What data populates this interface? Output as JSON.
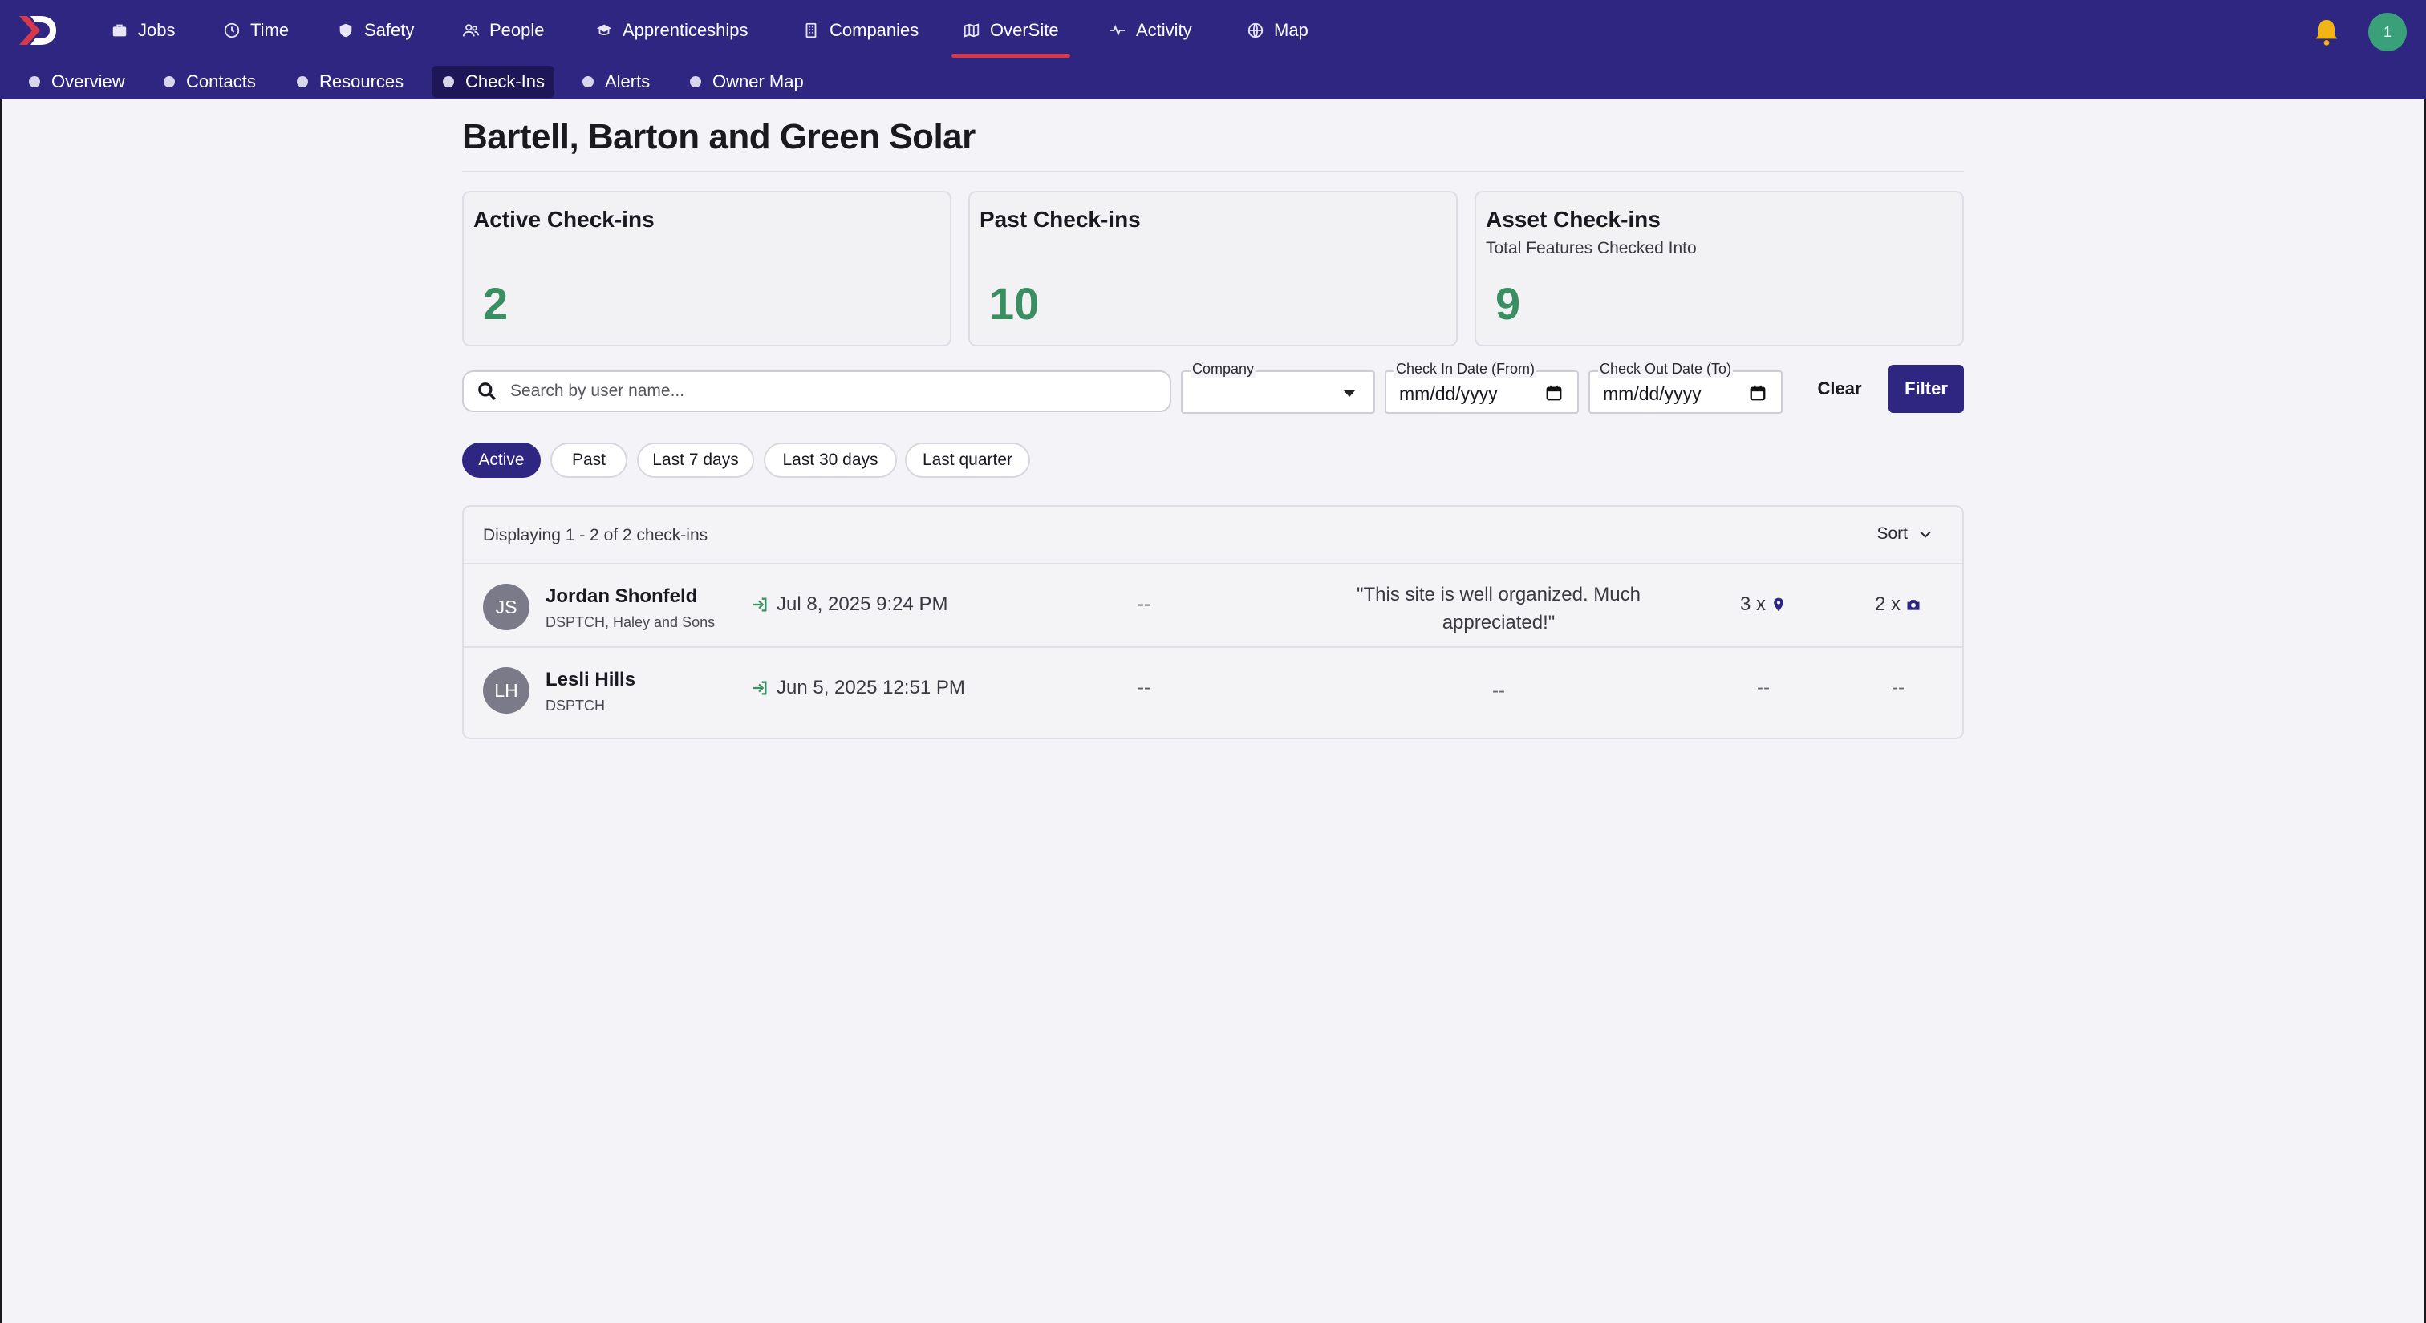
{
  "nav": {
    "items": [
      {
        "label": "Jobs",
        "icon": "briefcase-icon"
      },
      {
        "label": "Time",
        "icon": "clock-icon"
      },
      {
        "label": "Safety",
        "icon": "shield-icon"
      },
      {
        "label": "People",
        "icon": "people-icon"
      },
      {
        "label": "Apprenticeships",
        "icon": "graduation-cap-icon"
      },
      {
        "label": "Companies",
        "icon": "building-icon"
      },
      {
        "label": "OverSite",
        "icon": "map-icon",
        "active": true
      },
      {
        "label": "Activity",
        "icon": "pulse-icon"
      },
      {
        "label": "Map",
        "icon": "globe-icon"
      }
    ],
    "notification_count": "1"
  },
  "subnav": {
    "items": [
      "Overview",
      "Contacts",
      "Resources",
      "Check-Ins",
      "Alerts",
      "Owner Map"
    ],
    "active": "Check-Ins"
  },
  "page": {
    "title": "Bartell, Barton and Green Solar"
  },
  "cards": [
    {
      "label": "Active Check-ins",
      "sublabel": "",
      "value": "2"
    },
    {
      "label": "Past Check-ins",
      "sublabel": "",
      "value": "10"
    },
    {
      "label": "Asset Check-ins",
      "sublabel": "Total Features Checked Into",
      "value": "9"
    }
  ],
  "filters": {
    "search_placeholder": "Search by user name...",
    "company_label": "Company",
    "company_value": "",
    "checkin_label": "Check In Date (From)",
    "checkin_value": "mm/dd/yyyy",
    "checkout_label": "Check Out Date (To)",
    "checkout_value": "mm/dd/yyyy",
    "clear_label": "Clear",
    "filter_label": "Filter",
    "quick": [
      "Active",
      "Past",
      "Last 7 days",
      "Last 30 days",
      "Last quarter"
    ],
    "quick_active": "Active"
  },
  "table": {
    "count_text": "Displaying 1 - 2 of 2 check-ins",
    "sort_label": "Sort",
    "rows": [
      {
        "initials": "JS",
        "name": "Jordan Shonfeld",
        "company": "DSPTCH, Haley and Sons",
        "checkin": "Jul 8, 2025 9:24 PM",
        "checkout": "--",
        "note": "\"This site is well organized. Much appreciated!\"",
        "features": "3 x",
        "photos": "2 x"
      },
      {
        "initials": "LH",
        "name": "Lesli Hills",
        "company": "DSPTCH",
        "checkin": "Jun 5, 2025 12:51 PM",
        "checkout": "--",
        "note": "--",
        "features": "--",
        "photos": "--"
      }
    ]
  },
  "colors": {
    "nav_bg": "#2e2680",
    "accent_green": "#3a8f62",
    "active_underline": "#d63a4a",
    "bell": "#f2b516"
  }
}
